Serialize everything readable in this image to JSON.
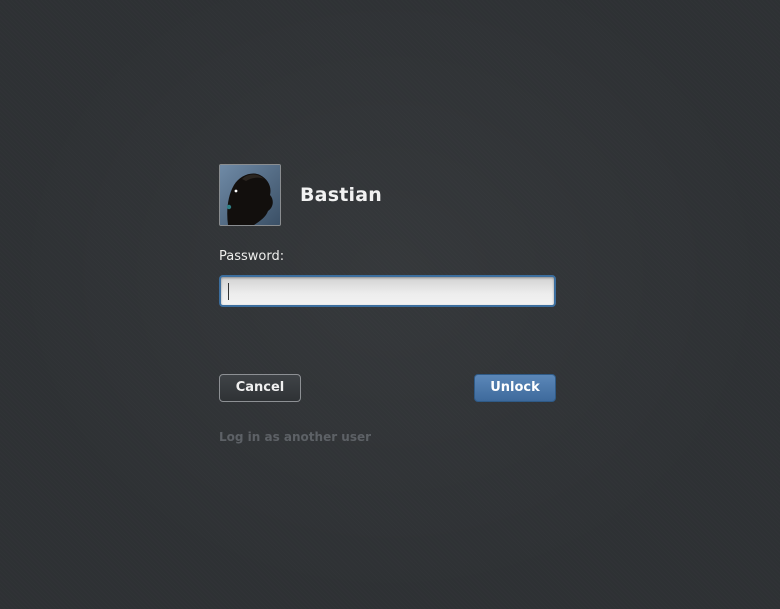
{
  "user": {
    "name": "Bastian",
    "avatar": "user-photo"
  },
  "prompt": {
    "label": "Password:",
    "value": ""
  },
  "buttons": {
    "cancel_label": "Cancel",
    "unlock_label": "Unlock"
  },
  "other_user_link": "Log in as another user",
  "colors": {
    "background": "#2e3134",
    "focus_border": "#3c6e9e",
    "unlock_button": "#4a76a8",
    "muted_link": "#5d6166"
  }
}
